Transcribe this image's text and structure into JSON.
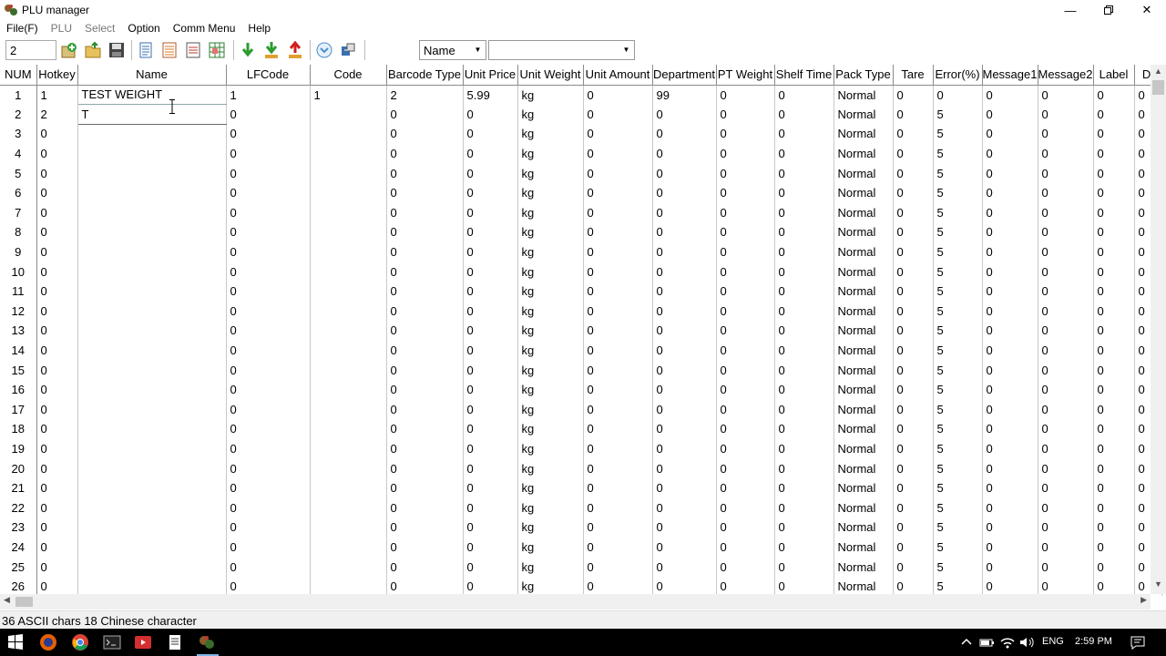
{
  "window": {
    "title": "PLU manager",
    "minimize_icon": "minimize-icon",
    "restore_icon": "restore-icon",
    "close_icon": "close-icon"
  },
  "menu": {
    "file": "File(F)",
    "plu": "PLU",
    "select": "Select",
    "option": "Option",
    "comm": "Comm Menu",
    "help": "Help"
  },
  "toolbar": {
    "record_value": "2",
    "search_field": "Name",
    "search_value": ""
  },
  "table": {
    "columns": [
      "NUM",
      "Hotkey",
      "Name",
      "LFCode",
      "Code",
      "Barcode Type",
      "Unit Price",
      "Unit Weight",
      "Unit Amount",
      "Department",
      "PT Weight",
      "Shelf Time",
      "Pack Type",
      "Tare",
      "Error(%)",
      "Message1",
      "Message2",
      "Label",
      "Di"
    ],
    "rows": [
      [
        "1",
        "1",
        "TEST WEIGHT",
        "1",
        "1",
        "2",
        "5.99",
        "kg",
        "0",
        "99",
        "0",
        "0",
        "Normal",
        "0",
        "0",
        "0",
        "0",
        "0",
        "0"
      ],
      [
        "2",
        "2",
        "T",
        "0",
        "",
        "0",
        "0",
        "kg",
        "0",
        "0",
        "0",
        "0",
        "Normal",
        "0",
        "5",
        "0",
        "0",
        "0",
        "0"
      ],
      [
        "3",
        "0",
        "",
        "0",
        "",
        "0",
        "0",
        "kg",
        "0",
        "0",
        "0",
        "0",
        "Normal",
        "0",
        "5",
        "0",
        "0",
        "0",
        "0"
      ],
      [
        "4",
        "0",
        "",
        "0",
        "",
        "0",
        "0",
        "kg",
        "0",
        "0",
        "0",
        "0",
        "Normal",
        "0",
        "5",
        "0",
        "0",
        "0",
        "0"
      ],
      [
        "5",
        "0",
        "",
        "0",
        "",
        "0",
        "0",
        "kg",
        "0",
        "0",
        "0",
        "0",
        "Normal",
        "0",
        "5",
        "0",
        "0",
        "0",
        "0"
      ],
      [
        "6",
        "0",
        "",
        "0",
        "",
        "0",
        "0",
        "kg",
        "0",
        "0",
        "0",
        "0",
        "Normal",
        "0",
        "5",
        "0",
        "0",
        "0",
        "0"
      ],
      [
        "7",
        "0",
        "",
        "0",
        "",
        "0",
        "0",
        "kg",
        "0",
        "0",
        "0",
        "0",
        "Normal",
        "0",
        "5",
        "0",
        "0",
        "0",
        "0"
      ],
      [
        "8",
        "0",
        "",
        "0",
        "",
        "0",
        "0",
        "kg",
        "0",
        "0",
        "0",
        "0",
        "Normal",
        "0",
        "5",
        "0",
        "0",
        "0",
        "0"
      ],
      [
        "9",
        "0",
        "",
        "0",
        "",
        "0",
        "0",
        "kg",
        "0",
        "0",
        "0",
        "0",
        "Normal",
        "0",
        "5",
        "0",
        "0",
        "0",
        "0"
      ],
      [
        "10",
        "0",
        "",
        "0",
        "",
        "0",
        "0",
        "kg",
        "0",
        "0",
        "0",
        "0",
        "Normal",
        "0",
        "5",
        "0",
        "0",
        "0",
        "0"
      ],
      [
        "11",
        "0",
        "",
        "0",
        "",
        "0",
        "0",
        "kg",
        "0",
        "0",
        "0",
        "0",
        "Normal",
        "0",
        "5",
        "0",
        "0",
        "0",
        "0"
      ],
      [
        "12",
        "0",
        "",
        "0",
        "",
        "0",
        "0",
        "kg",
        "0",
        "0",
        "0",
        "0",
        "Normal",
        "0",
        "5",
        "0",
        "0",
        "0",
        "0"
      ],
      [
        "13",
        "0",
        "",
        "0",
        "",
        "0",
        "0",
        "kg",
        "0",
        "0",
        "0",
        "0",
        "Normal",
        "0",
        "5",
        "0",
        "0",
        "0",
        "0"
      ],
      [
        "14",
        "0",
        "",
        "0",
        "",
        "0",
        "0",
        "kg",
        "0",
        "0",
        "0",
        "0",
        "Normal",
        "0",
        "5",
        "0",
        "0",
        "0",
        "0"
      ],
      [
        "15",
        "0",
        "",
        "0",
        "",
        "0",
        "0",
        "kg",
        "0",
        "0",
        "0",
        "0",
        "Normal",
        "0",
        "5",
        "0",
        "0",
        "0",
        "0"
      ],
      [
        "16",
        "0",
        "",
        "0",
        "",
        "0",
        "0",
        "kg",
        "0",
        "0",
        "0",
        "0",
        "Normal",
        "0",
        "5",
        "0",
        "0",
        "0",
        "0"
      ],
      [
        "17",
        "0",
        "",
        "0",
        "",
        "0",
        "0",
        "kg",
        "0",
        "0",
        "0",
        "0",
        "Normal",
        "0",
        "5",
        "0",
        "0",
        "0",
        "0"
      ],
      [
        "18",
        "0",
        "",
        "0",
        "",
        "0",
        "0",
        "kg",
        "0",
        "0",
        "0",
        "0",
        "Normal",
        "0",
        "5",
        "0",
        "0",
        "0",
        "0"
      ],
      [
        "19",
        "0",
        "",
        "0",
        "",
        "0",
        "0",
        "kg",
        "0",
        "0",
        "0",
        "0",
        "Normal",
        "0",
        "5",
        "0",
        "0",
        "0",
        "0"
      ],
      [
        "20",
        "0",
        "",
        "0",
        "",
        "0",
        "0",
        "kg",
        "0",
        "0",
        "0",
        "0",
        "Normal",
        "0",
        "5",
        "0",
        "0",
        "0",
        "0"
      ],
      [
        "21",
        "0",
        "",
        "0",
        "",
        "0",
        "0",
        "kg",
        "0",
        "0",
        "0",
        "0",
        "Normal",
        "0",
        "5",
        "0",
        "0",
        "0",
        "0"
      ],
      [
        "22",
        "0",
        "",
        "0",
        "",
        "0",
        "0",
        "kg",
        "0",
        "0",
        "0",
        "0",
        "Normal",
        "0",
        "5",
        "0",
        "0",
        "0",
        "0"
      ],
      [
        "23",
        "0",
        "",
        "0",
        "",
        "0",
        "0",
        "kg",
        "0",
        "0",
        "0",
        "0",
        "Normal",
        "0",
        "5",
        "0",
        "0",
        "0",
        "0"
      ],
      [
        "24",
        "0",
        "",
        "0",
        "",
        "0",
        "0",
        "kg",
        "0",
        "0",
        "0",
        "0",
        "Normal",
        "0",
        "5",
        "0",
        "0",
        "0",
        "0"
      ],
      [
        "25",
        "0",
        "",
        "0",
        "",
        "0",
        "0",
        "kg",
        "0",
        "0",
        "0",
        "0",
        "Normal",
        "0",
        "5",
        "0",
        "0",
        "0",
        "0"
      ],
      [
        "26",
        "0",
        "",
        "0",
        "",
        "0",
        "0",
        "kg",
        "0",
        "0",
        "0",
        "0",
        "Normal",
        "0",
        "5",
        "0",
        "0",
        "0",
        "0"
      ]
    ]
  },
  "status": {
    "text": "36 ASCII chars 18 Chinese character"
  },
  "taskbar": {
    "language": "ENG",
    "time": "2:59 PM"
  }
}
